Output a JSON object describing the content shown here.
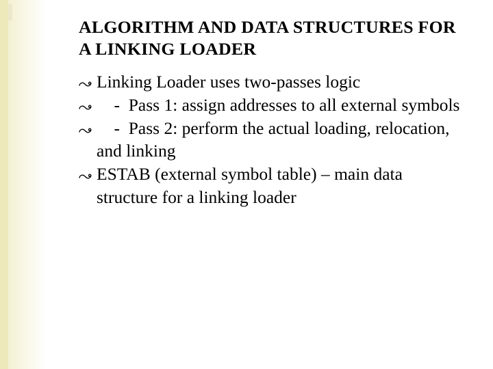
{
  "slide": {
    "title": "ALGORITHM AND DATA STRUCTURES FOR A LINKING LOADER",
    "bullets": [
      "Linking Loader uses two-passes logic",
      "    -  Pass 1: assign addresses to all external symbols",
      "    -  Pass 2: perform the actual loading, relocation, and linking",
      "ESTAB (external symbol table) – main data structure for a linking loader"
    ]
  }
}
